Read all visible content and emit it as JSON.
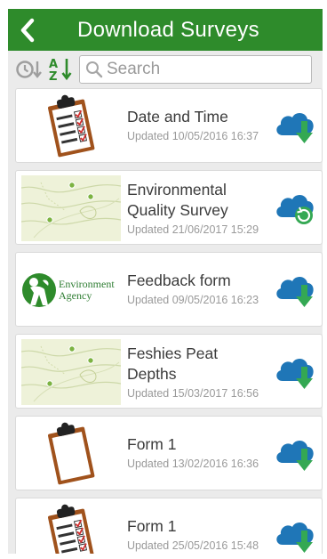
{
  "header": {
    "title": "Download Surveys"
  },
  "toolbar": {
    "search_placeholder": "Search"
  },
  "colors": {
    "header_bg": "#2e8b2b",
    "cloud_blue": "#1f76b7",
    "arrow_green": "#34a853"
  },
  "surveys": [
    {
      "name_lines": [
        "Date and Time"
      ],
      "updated": "Updated 10/05/2016 16:37",
      "thumb": "clipboard-checklist",
      "status": "download"
    },
    {
      "name_lines": [
        "Environmental",
        "Quality Survey"
      ],
      "updated": "Updated 21/06/2017 15:29",
      "thumb": "map",
      "status": "update"
    },
    {
      "name_lines": [
        "Feedback form"
      ],
      "updated": "Updated 09/05/2016 16:23",
      "thumb": "environment-agency-logo",
      "logo_lines": [
        "Environment",
        "Agency"
      ],
      "status": "download"
    },
    {
      "name_lines": [
        "Feshies Peat",
        "Depths"
      ],
      "updated": "Updated 15/03/2017 16:56",
      "thumb": "map",
      "status": "download"
    },
    {
      "name_lines": [
        "Form 1"
      ],
      "updated": "Updated 13/02/2016 16:36",
      "thumb": "clipboard-blank",
      "status": "download"
    },
    {
      "name_lines": [
        "Form 1"
      ],
      "updated": "Updated 25/05/2016 15:48",
      "thumb": "clipboard-checklist",
      "status": "download"
    }
  ]
}
